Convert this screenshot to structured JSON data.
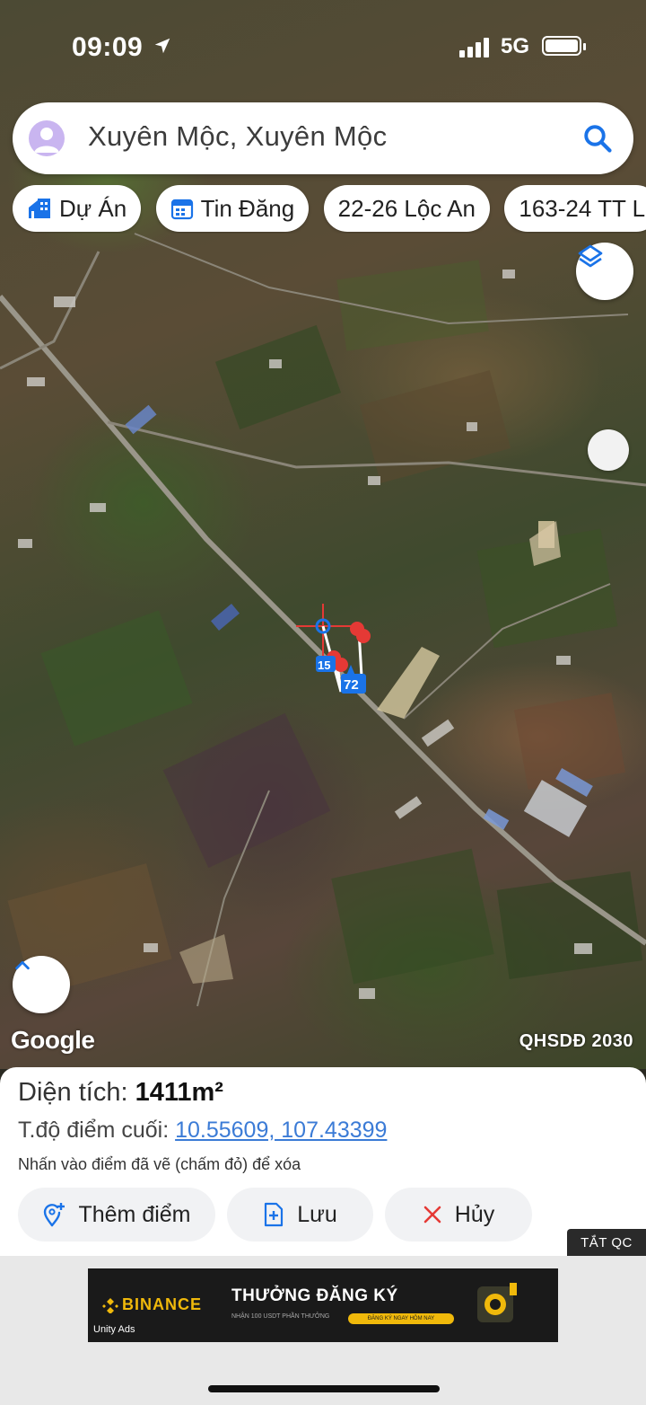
{
  "status_bar": {
    "time": "09:09",
    "network": "5G"
  },
  "search": {
    "text": "Xuyên Mộc, Xuyên Mộc"
  },
  "chips": [
    {
      "label": "Dự Án",
      "icon": "building-icon"
    },
    {
      "label": "Tin Đăng",
      "icon": "calendar-icon"
    },
    {
      "label": "22-26 Lộc An"
    },
    {
      "label": "163-24 TT L"
    }
  ],
  "map": {
    "logo": "Google",
    "plan_label": "QHSDĐ 2030",
    "markers": {
      "parcel_a": "15",
      "parcel_b": "72"
    }
  },
  "sheet": {
    "area_label": "Diện tích: ",
    "area_value": "1411m²",
    "coord_label": "T.độ điểm cuối: ",
    "coord_value": "10.55609, 107.43399",
    "hint": "Nhấn vào điểm đã vẽ (chấm đỏ) để xóa",
    "add_label": "Thêm điểm",
    "save_label": "Lưu",
    "cancel_label": "Hủy"
  },
  "ad": {
    "close_label": "TẮT QC",
    "brand": "BINANCE",
    "title": "THƯỞNG ĐĂNG KÝ",
    "subtitle": "NHẬN 100 USDT PHẦN THƯỞNG",
    "cta": "ĐĂNG KÝ NGAY HÔM NAY",
    "network": "Unity Ads"
  },
  "colors": {
    "link": "#3b7bd6",
    "accent_blue": "#1a73e8",
    "marker_red": "#e53935",
    "cancel_red": "#e53935"
  }
}
